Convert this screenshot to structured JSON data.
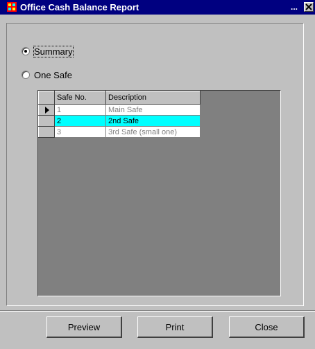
{
  "window": {
    "title": "Office Cash Balance Report",
    "title_extra": "...",
    "icon": "report-app-icon",
    "close_icon": "close-x-icon"
  },
  "options": [
    {
      "label": "Summary",
      "checked": true
    },
    {
      "label": "One Safe",
      "checked": false
    }
  ],
  "grid": {
    "columns": [
      "Safe No.",
      "Description"
    ],
    "rows": [
      {
        "safe_no": "1",
        "description": "Main Safe",
        "current": true,
        "selected": false
      },
      {
        "safe_no": "2",
        "description": "2nd Safe",
        "current": false,
        "selected": true
      },
      {
        "safe_no": "3",
        "description": "3rd Safe (small one)",
        "current": false,
        "selected": false
      }
    ],
    "selected_color": "#00ffff"
  },
  "buttons": {
    "preview": "Preview",
    "print": "Print",
    "close": "Close"
  }
}
